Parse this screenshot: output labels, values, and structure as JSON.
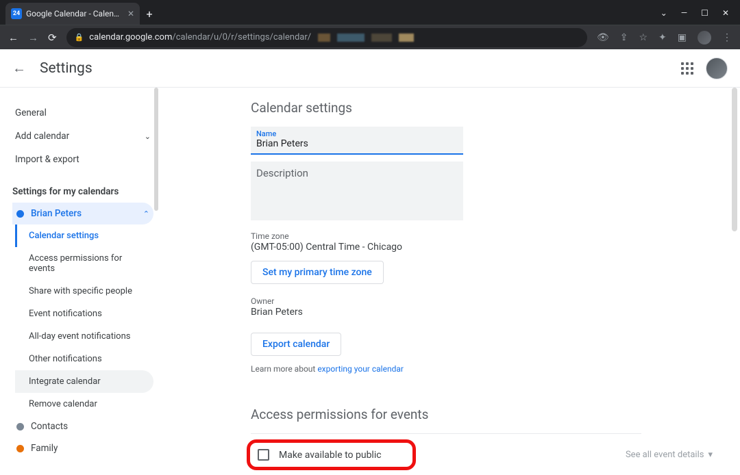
{
  "browser": {
    "tab_title": "Google Calendar - Calendar setti",
    "url_domain": "calendar.google.com",
    "url_path": "/calendar/u/0/r/settings/calendar/"
  },
  "header": {
    "title": "Settings"
  },
  "sidebar": {
    "general": "General",
    "add_calendar": "Add calendar",
    "import_export": "Import & export",
    "section_label": "Settings for my calendars",
    "calendars": [
      {
        "name": "Brian Peters",
        "color": "#1a73e8",
        "expanded": true,
        "active": true
      },
      {
        "name": "Contacts",
        "color": "#7b8794",
        "expanded": false
      },
      {
        "name": "Family",
        "color": "#e8710a",
        "expanded": false
      }
    ],
    "sub_items": {
      "calendar_settings": "Calendar settings",
      "access_permissions": "Access permissions for events",
      "share_specific": "Share with specific people",
      "event_notifications": "Event notifications",
      "allday_notifications": "All-day event notifications",
      "other_notifications": "Other notifications",
      "integrate": "Integrate calendar",
      "remove": "Remove calendar"
    }
  },
  "main": {
    "section1_title": "Calendar settings",
    "name_label": "Name",
    "name_value": "Brian Peters",
    "description_label": "Description",
    "tz_label": "Time zone",
    "tz_value": "(GMT-05:00) Central Time - Chicago",
    "tz_button": "Set my primary time zone",
    "owner_label": "Owner",
    "owner_value": "Brian Peters",
    "export_button": "Export calendar",
    "learn_more_pre": "Learn more about ",
    "learn_more_link": "exporting your calendar",
    "section2_title": "Access permissions for events",
    "public_checkbox_label": "Make available to public",
    "details_dropdown": "See all event details"
  }
}
